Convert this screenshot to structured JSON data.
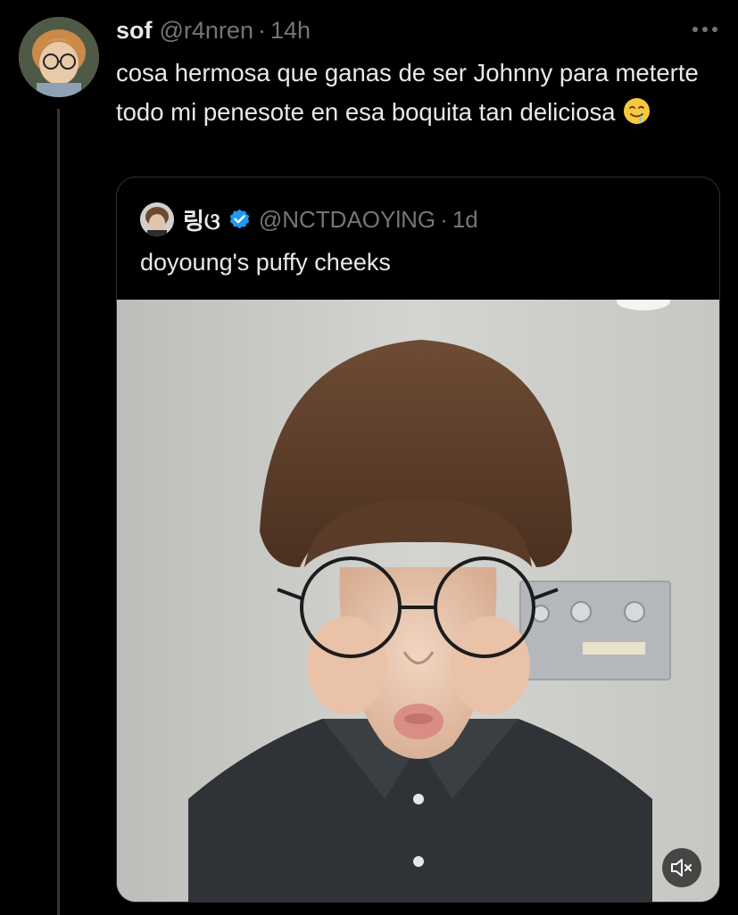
{
  "tweet": {
    "display_name": "sof",
    "handle": "@r4nren",
    "separator": "·",
    "time": "14h",
    "text": "cosa hermosa que ganas de ser Johnny para meterte todo mi penesote en esa boquita tan deliciosa",
    "emoji": "drooling-face-icon"
  },
  "quote": {
    "display_name": "링ଓ",
    "verified": true,
    "handle": "@NCTDAOYlNG",
    "separator": "·",
    "time": "1d",
    "text": "doyoung's puffy cheeks",
    "media": {
      "type": "video",
      "muted": true
    }
  },
  "icons": {
    "more": "more-horizontal-icon",
    "verified": "verified-badge-icon",
    "mute": "speaker-muted-icon"
  },
  "colors": {
    "background": "#000000",
    "text_primary": "#e7e9ea",
    "text_secondary": "#71767b",
    "border": "#2f3336",
    "verified_blue": "#1d9bf0"
  }
}
